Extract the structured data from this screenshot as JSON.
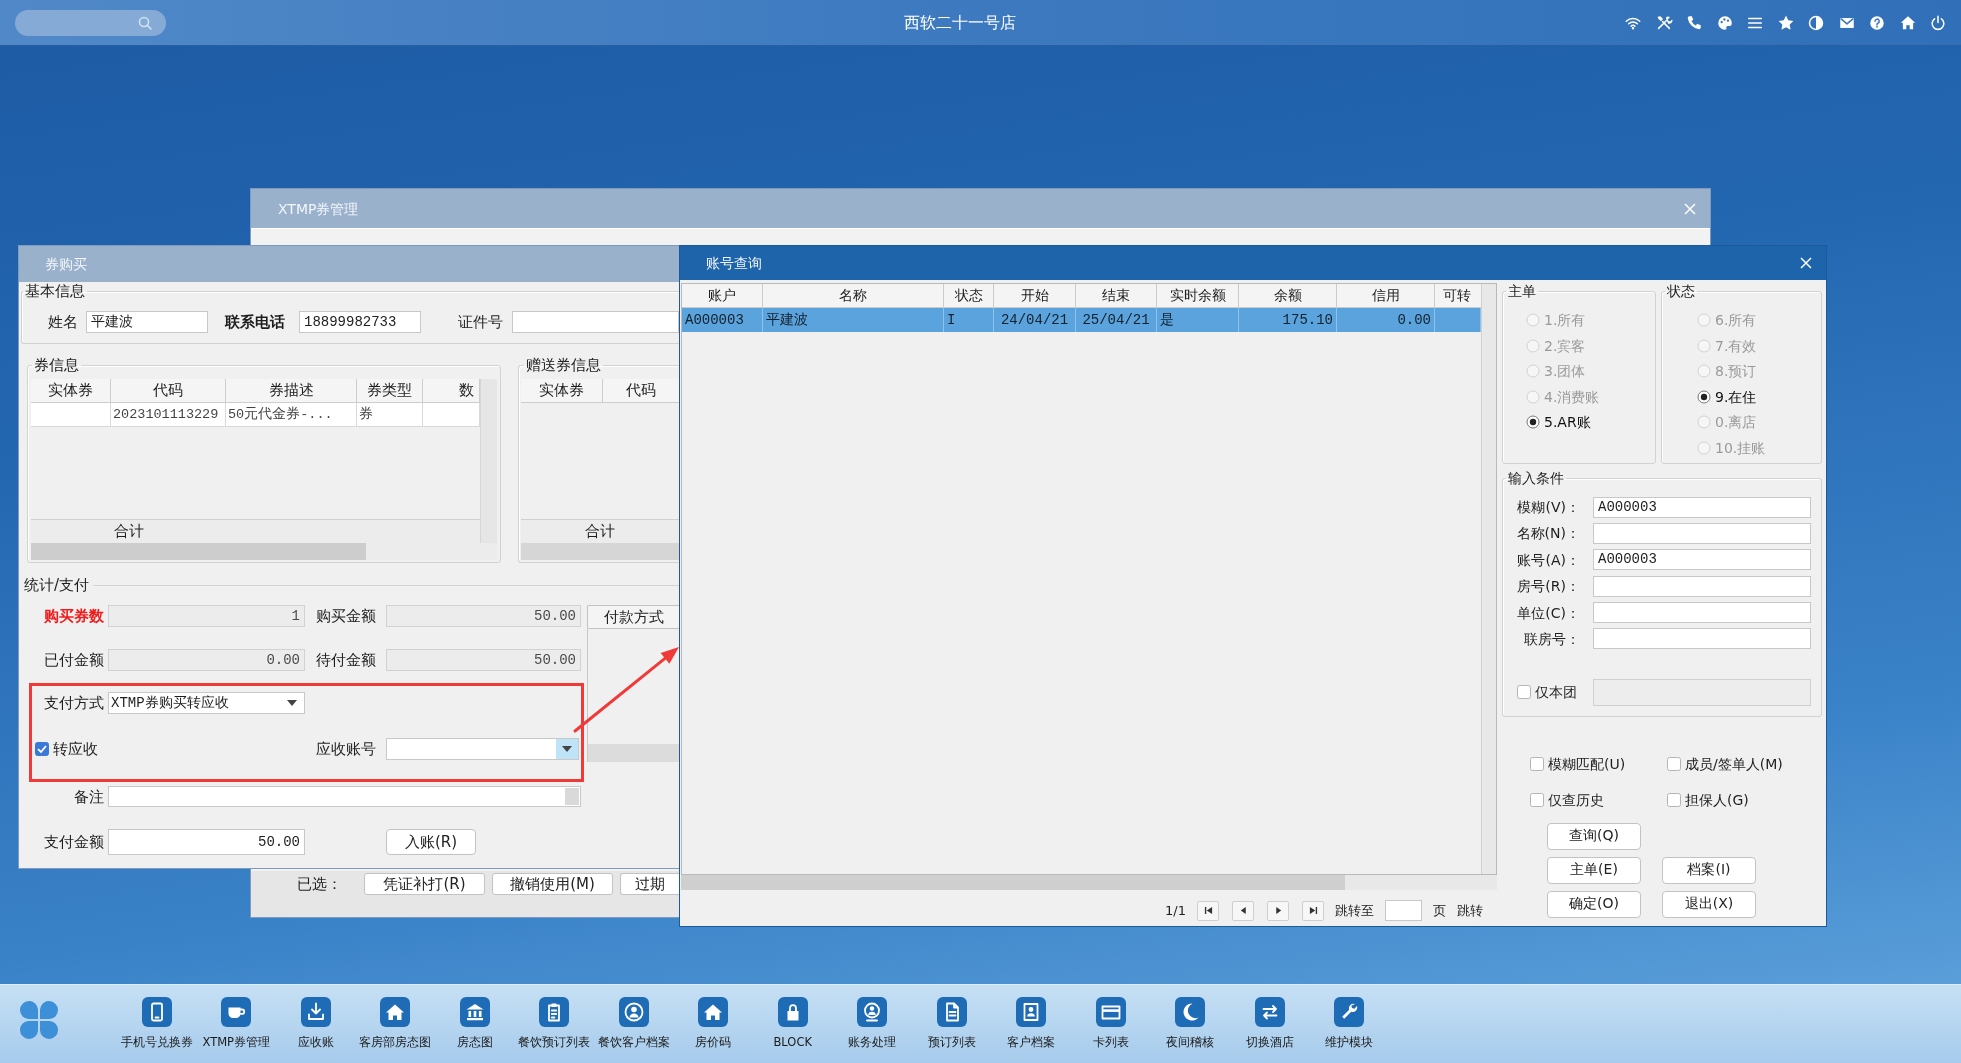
{
  "top_bar": {
    "title": "西软二十一号店"
  },
  "coupon_manager": {
    "title": "XTMP券管理",
    "selected_label": "已选：",
    "buttons": [
      "凭证补打(R)",
      "撤销使用(M)",
      "过期"
    ]
  },
  "coupon_purchase": {
    "title": "券购买",
    "basic_info": {
      "title": "基本信息",
      "fields": [
        {
          "label": "姓名",
          "value": "平建波",
          "emphasized": false
        },
        {
          "label": "联系电话",
          "value": "18899982733",
          "emphasized": true
        },
        {
          "label": "证件号",
          "emphasized": false
        }
      ]
    },
    "coupon_info": {
      "title": "券信息",
      "columns": [
        "实体券",
        "代码",
        "券描述",
        "券类型",
        "数"
      ],
      "rows": [
        {
          "code": "2023101113229",
          "description": "50元代金券-...",
          "coupon_type": "券"
        }
      ],
      "footer": "合计"
    },
    "gift_coupons": {
      "title": "赠送券信息",
      "columns": [
        "实体券",
        "代码"
      ],
      "footer": "合计"
    },
    "payment": {
      "title": "统计/支付",
      "summary": [
        {
          "label": "购买券数",
          "value": "1",
          "highlighted": true
        },
        {
          "label": "购买金额",
          "value": "50.00",
          "highlighted": false
        },
        {
          "label": "已付金额",
          "value": "0.00",
          "highlighted": false
        },
        {
          "label": "待付金额",
          "value": "50.00",
          "highlighted": false
        }
      ],
      "methods_button": "付款方式",
      "pay_method": {
        "label": "支付方式",
        "value": "XTMP券购买转应收"
      },
      "transfer_to_ar": {
        "label": "转应收",
        "checked": true
      },
      "ar_account": {
        "label": "应收账号"
      },
      "remark": {
        "label": "备注"
      },
      "pay_amount": {
        "label": "支付金额",
        "value": "50.00"
      },
      "post_button": "入账(R)"
    }
  },
  "account_query": {
    "title": "账号查询",
    "table": {
      "columns": [
        "账户",
        "名称",
        "状态",
        "开始",
        "结束",
        "实时余额",
        "余额",
        "信用",
        "可转"
      ],
      "rows": [
        {
          "selected": true,
          "cells": [
            "A000003",
            "平建波",
            "I",
            "24/04/21",
            "25/04/21",
            "是",
            "175.10",
            "0.00"
          ]
        }
      ]
    },
    "pager": {
      "page": "1/1",
      "goto_label": "跳转至",
      "page_unit": "页",
      "goto_button": "跳转"
    },
    "main_filter": {
      "title": "主单",
      "options": [
        {
          "label": "1.所有",
          "selected": false,
          "disabled": true
        },
        {
          "label": "2.宾客",
          "selected": false,
          "disabled": true
        },
        {
          "label": "3.团体",
          "selected": false,
          "disabled": true
        },
        {
          "label": "4.消费账",
          "selected": false,
          "disabled": true
        },
        {
          "label": "5.AR账",
          "selected": true,
          "disabled": false
        }
      ]
    },
    "status_filter": {
      "title": "状态",
      "options": [
        {
          "label": "6.所有",
          "selected": false,
          "disabled": true
        },
        {
          "label": "7.有效",
          "selected": false,
          "disabled": true
        },
        {
          "label": "8.预订",
          "selected": false,
          "disabled": true
        },
        {
          "label": "9.在住",
          "selected": true,
          "disabled": false
        },
        {
          "label": "0.离店",
          "selected": false,
          "disabled": true
        },
        {
          "label": "10.挂账",
          "selected": false,
          "disabled": true
        }
      ]
    },
    "conditions": {
      "title": "输入条件",
      "fields": [
        {
          "label": "模糊(V)：",
          "value": "A000003"
        },
        {
          "label": "名称(N)："
        },
        {
          "label": "账号(A)：",
          "value": "A000003"
        },
        {
          "label": "房号(R)："
        },
        {
          "label": "单位(C)："
        },
        {
          "label": "联房号："
        }
      ],
      "own_group": {
        "label": "仅本团",
        "checked": false
      },
      "own_group_field": {
        "disabled": true
      }
    },
    "options": [
      {
        "label": "模糊匹配(U)",
        "checked": false
      },
      {
        "label": "成员/签单人(M)",
        "checked": false
      },
      {
        "label": "仅查历史",
        "checked": false
      },
      {
        "label": "担保人(G)",
        "checked": false
      }
    ],
    "buttons": [
      "查询(Q)",
      "主单(E)",
      "档案(I)",
      "确定(O)",
      "退出(X)"
    ]
  },
  "taskbar": {
    "items": [
      "手机号兑换券",
      "XTMP券管理",
      "应收账",
      "客房部房态图",
      "房态图",
      "餐饮预订列表",
      "餐饮客户档案",
      "房价码",
      "BLOCK",
      "账务处理",
      "预订列表",
      "客户档案",
      "卡列表",
      "夜间稽核",
      "切换酒店",
      "维护模块"
    ]
  }
}
